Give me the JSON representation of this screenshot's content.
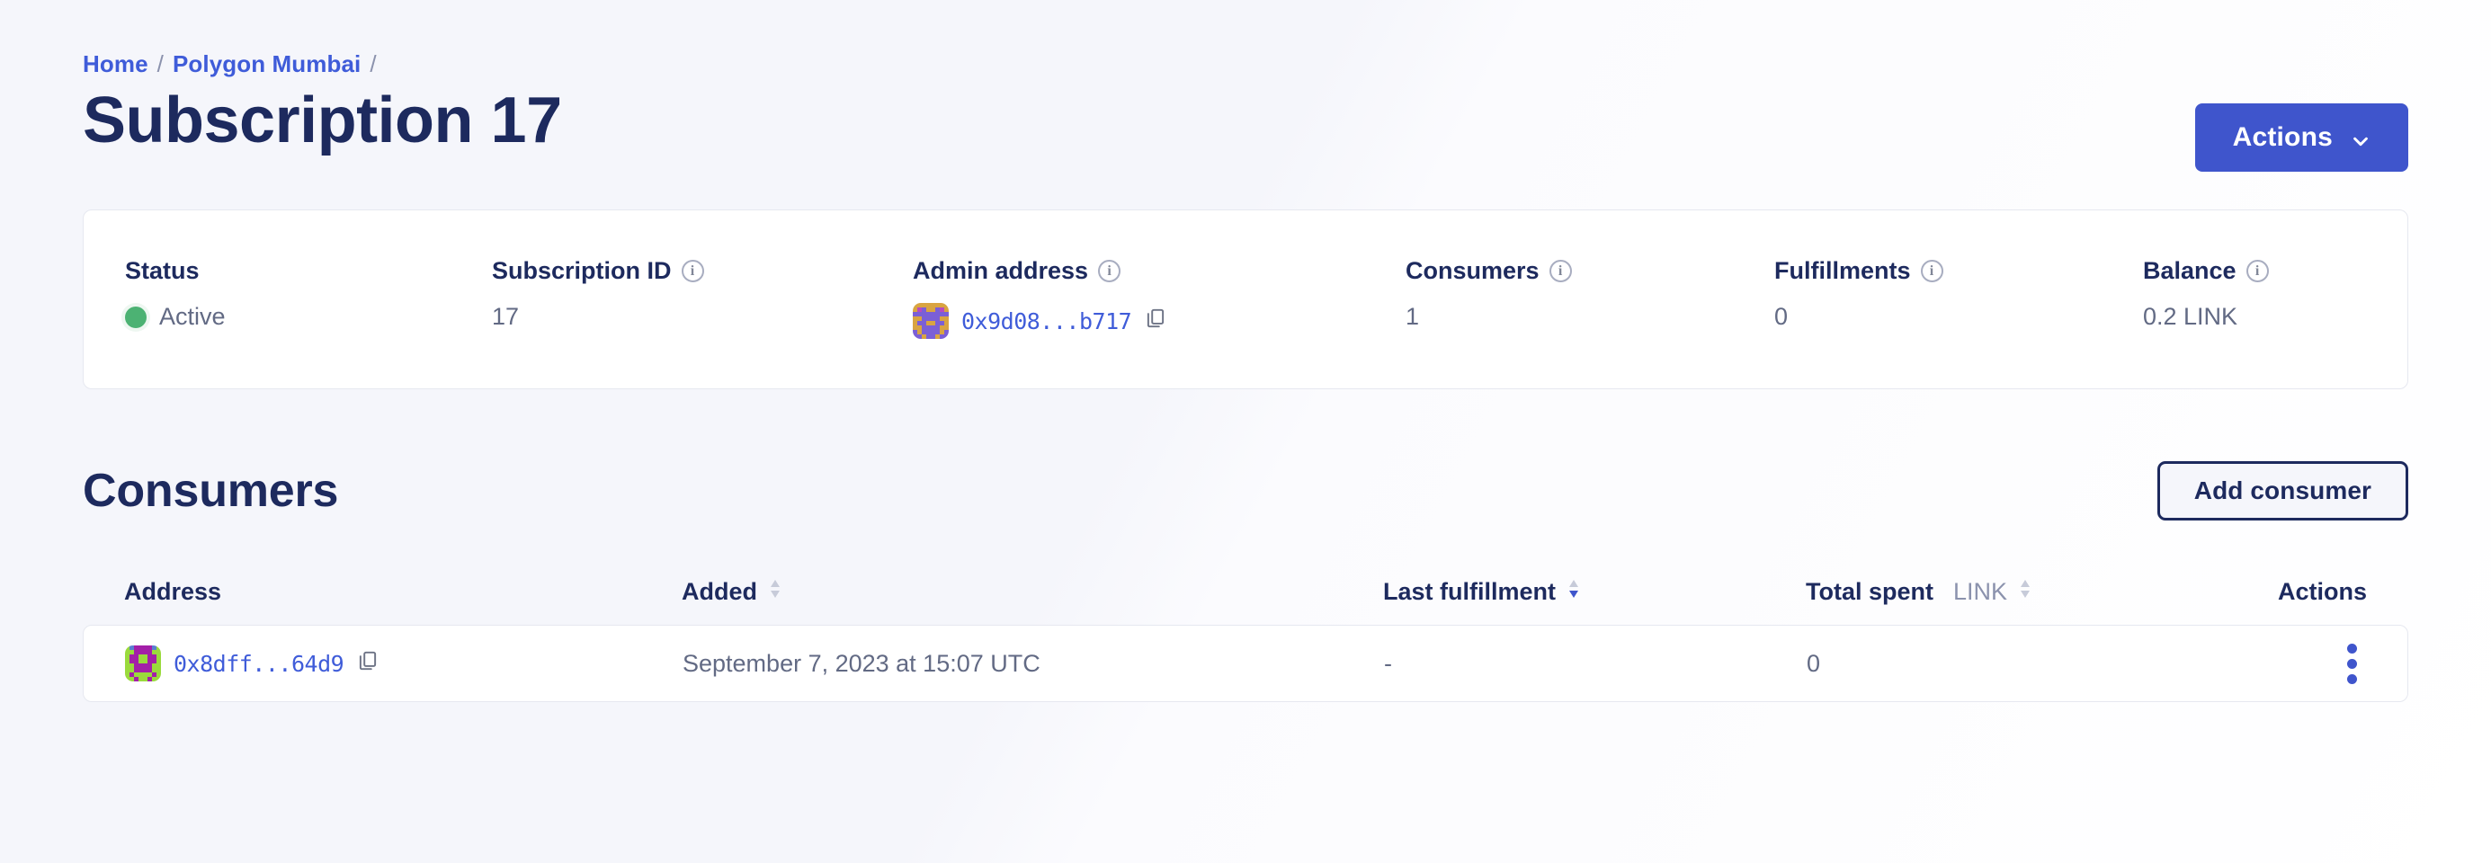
{
  "breadcrumb": {
    "items": [
      {
        "label": "Home"
      },
      {
        "label": "Polygon Mumbai"
      }
    ],
    "separator": "/",
    "trailing_separator": "/"
  },
  "header": {
    "title": "Subscription 17",
    "actions_button": "Actions",
    "chevron_icon": "chevron-down-icon"
  },
  "stats": {
    "status": {
      "label": "Status",
      "value": "Active",
      "dot_color": "#4cb273"
    },
    "subscription_id": {
      "label": "Subscription ID",
      "value": "17",
      "info_icon": "info-icon"
    },
    "admin_address": {
      "label": "Admin address",
      "value": "0x9d08...b717",
      "info_icon": "info-icon",
      "copy_icon": "copy-icon",
      "identicon": "blockie-identicon"
    },
    "consumers": {
      "label": "Consumers",
      "value": "1",
      "info_icon": "info-icon"
    },
    "fulfillments": {
      "label": "Fulfillments",
      "value": "0",
      "info_icon": "info-icon"
    },
    "balance": {
      "label": "Balance",
      "value": "0.2 LINK",
      "info_icon": "info-icon"
    }
  },
  "consumers_section": {
    "title": "Consumers",
    "add_button": "Add consumer",
    "table": {
      "columns": [
        {
          "label": "Address",
          "sortable": false,
          "sort_state": "none"
        },
        {
          "label": "Added",
          "sortable": true,
          "sort_state": "none"
        },
        {
          "label": "Last fulfillment",
          "sortable": true,
          "sort_state": "desc"
        },
        {
          "label": "Total spent",
          "unit": "LINK",
          "sortable": true,
          "sort_state": "none"
        },
        {
          "label": "Actions",
          "sortable": false,
          "sort_state": "none"
        }
      ],
      "rows": [
        {
          "address": "0x8dff...64d9",
          "added": "September 7, 2023 at 15:07 UTC",
          "last_fulfillment": "-",
          "total_spent": "0",
          "actions_icon": "kebab-menu-icon"
        }
      ]
    }
  },
  "colors": {
    "accent_blue": "#3f55cc",
    "link_blue": "#3f5cd9",
    "navy": "#1d2a5e",
    "muted_text": "#626a84",
    "status_green": "#4cb273",
    "page_bg": "#f7f8fc"
  }
}
